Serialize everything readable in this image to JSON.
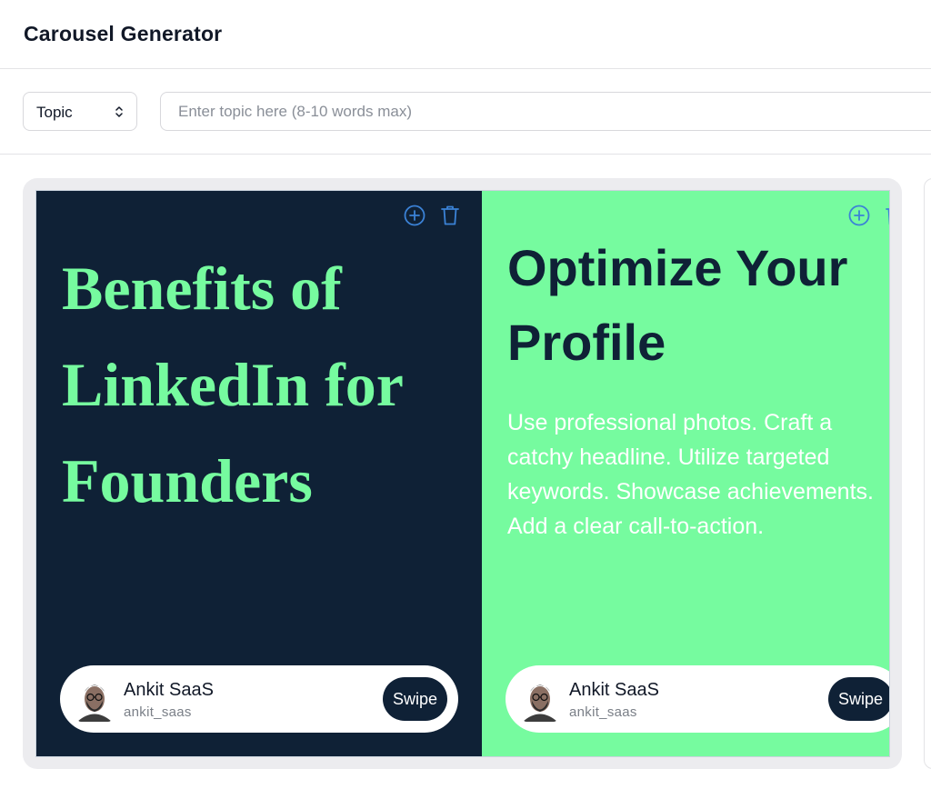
{
  "header": {
    "title": "Carousel Generator"
  },
  "controls": {
    "type_select": {
      "value": "Topic"
    },
    "topic_input": {
      "value": "",
      "placeholder": "Enter topic here (8-10 words max)"
    }
  },
  "slides": [
    {
      "title_lines": [
        "Benefits of",
        "LinkedIn for",
        "Founders"
      ],
      "body": "",
      "background": "#0f2136",
      "title_color": "#76fb9f",
      "actions": {
        "add_icon": "plus-circle-icon",
        "delete_icon": "trash-icon"
      },
      "profile": {
        "name": "Ankit SaaS",
        "handle": "ankit_saas",
        "swipe_label": "Swipe"
      }
    },
    {
      "title_lines": [
        "Optimize Your",
        "Profile"
      ],
      "body_lines": [
        "Use professional photos. Craft a",
        "catchy headline. Utilize targeted",
        "keywords. Showcase achievements.",
        "Add a clear call-to-action."
      ],
      "background": "#76fb9f",
      "title_color": "#0f2136",
      "actions": {
        "add_icon": "plus-circle-icon",
        "delete_icon": "trash-icon"
      },
      "profile": {
        "name": "Ankit SaaS",
        "handle": "ankit_saas",
        "swipe_label": "Swipe"
      }
    }
  ],
  "colors": {
    "accent_blue": "#3b82d6",
    "dark_navy": "#0f2136",
    "mint_green": "#76fb9f"
  }
}
